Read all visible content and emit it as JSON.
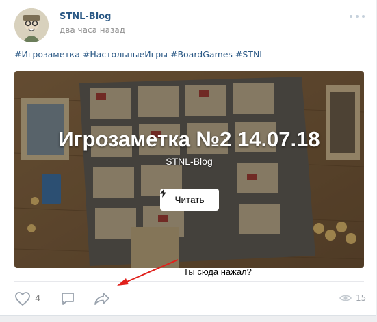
{
  "post": {
    "author": "STNL-Blog",
    "time": "два часа назад",
    "tags": "#Игрозаметка #НастольныеИгры #BoardGames #STNL"
  },
  "media": {
    "title": "Игрозаметка №2 14.07.18",
    "subtitle": "STNL-Blog",
    "button_label": "Читать"
  },
  "actions": {
    "likes": "4",
    "views": "15"
  },
  "annotation": "Ты сюда нажал?",
  "colors": {
    "link": "#2a5885",
    "icon": "#99a2ad",
    "arrow": "#e0201b"
  },
  "icons": [
    "more-icon",
    "bolt-icon",
    "heart-icon",
    "comment-icon",
    "share-icon",
    "eye-icon"
  ]
}
